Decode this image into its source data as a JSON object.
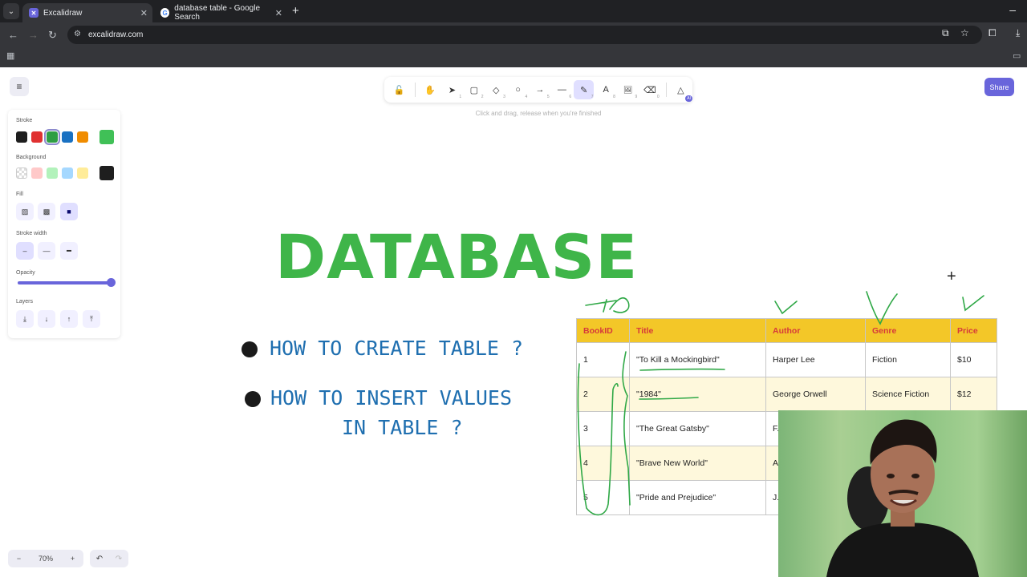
{
  "browser": {
    "tabs": [
      {
        "title": "Excalidraw",
        "active": true
      },
      {
        "title": "database table - Google Search",
        "active": false
      }
    ],
    "url": "excalidraw.com"
  },
  "toolbar": {
    "tools": [
      {
        "name": "lock",
        "glyph": "🔓",
        "key": ""
      },
      {
        "name": "hand",
        "glyph": "✋",
        "key": ""
      },
      {
        "name": "selection",
        "glyph": "➤",
        "key": "1"
      },
      {
        "name": "rectangle",
        "glyph": "▢",
        "key": "2"
      },
      {
        "name": "diamond",
        "glyph": "◇",
        "key": "3"
      },
      {
        "name": "ellipse",
        "glyph": "○",
        "key": "4"
      },
      {
        "name": "arrow",
        "glyph": "→",
        "key": "5"
      },
      {
        "name": "line",
        "glyph": "—",
        "key": "6"
      },
      {
        "name": "draw",
        "glyph": "✎",
        "key": "7"
      },
      {
        "name": "text",
        "glyph": "A",
        "key": "8"
      },
      {
        "name": "image",
        "glyph": "🖼",
        "key": "9"
      },
      {
        "name": "eraser",
        "glyph": "⌫",
        "key": "0"
      }
    ],
    "ai_badge": "AI",
    "hint": "Click and drag, release when you're finished",
    "share_label": "Share"
  },
  "properties": {
    "stroke_label": "Stroke",
    "stroke_colors": [
      "#1e1e1e",
      "#e03131",
      "#2f9e44",
      "#1971c2",
      "#f08c00"
    ],
    "stroke_current": "#40c057",
    "background_label": "Background",
    "background_colors": [
      "transparent",
      "#ffc9c9",
      "#b2f2bb",
      "#a5d8ff",
      "#ffec99"
    ],
    "background_current": "#1e1e1e",
    "fill_label": "Fill",
    "stroke_width_label": "Stroke width",
    "opacity_label": "Opacity",
    "opacity_value": 100,
    "layers_label": "Layers"
  },
  "zoom": {
    "minus": "−",
    "value": "70%",
    "plus": "+"
  },
  "slide": {
    "heading": "DATABASE",
    "bullet1": "HOW TO CREATE TABLE ?",
    "bullet2_line1": "HOW TO INSERT VALUES",
    "bullet2_line2": "IN TABLE ?"
  },
  "table": {
    "headers": [
      "BookID",
      "Title",
      "Author",
      "Genre",
      "Price"
    ],
    "rows": [
      [
        "1",
        "\"To Kill a Mockingbird\"",
        "Harper Lee",
        "Fiction",
        "$10"
      ],
      [
        "2",
        "\"1984\"",
        "George Orwell",
        "Science Fiction",
        "$12"
      ],
      [
        "3",
        "\"The Great Gatsby\"",
        "F.",
        "",
        ""
      ],
      [
        "4",
        "\"Brave New World\"",
        "A",
        "",
        ""
      ],
      [
        "5",
        "\"Pride and Prejudice\"",
        "J.",
        "",
        ""
      ]
    ]
  }
}
